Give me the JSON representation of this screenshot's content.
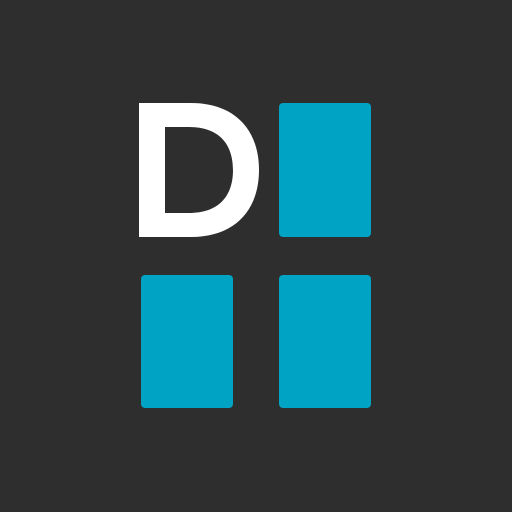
{
  "app_icon": {
    "letter": "D",
    "colors": {
      "background": "#2e2e2e",
      "letter": "#ffffff",
      "tile": "#00a3c4"
    },
    "tile_count": 3
  }
}
